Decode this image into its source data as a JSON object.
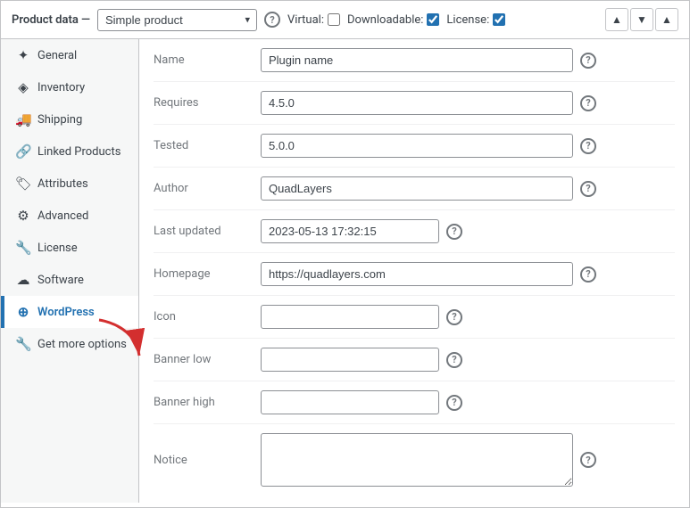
{
  "header": {
    "label": "Product data —",
    "product_type_value": "Simple product",
    "help_icon": "?",
    "virtual_label": "Virtual:",
    "virtual_checked": false,
    "downloadable_label": "Downloadable:",
    "downloadable_checked": true,
    "license_label": "License:",
    "license_checked": true,
    "nav_up": "▲",
    "nav_down": "▼",
    "nav_collapse": "▲"
  },
  "sidebar": {
    "items": [
      {
        "id": "general",
        "label": "General",
        "icon": "📄"
      },
      {
        "id": "inventory",
        "label": "Inventory",
        "icon": "📦"
      },
      {
        "id": "shipping",
        "label": "Shipping",
        "icon": "🚚"
      },
      {
        "id": "linked-products",
        "label": "Linked Products",
        "icon": "🔗"
      },
      {
        "id": "attributes",
        "label": "Attributes",
        "icon": "🏷"
      },
      {
        "id": "advanced",
        "label": "Advanced",
        "icon": "⚙"
      },
      {
        "id": "license",
        "label": "License",
        "icon": "🔧"
      },
      {
        "id": "software",
        "label": "Software",
        "icon": "☁"
      },
      {
        "id": "wordpress",
        "label": "WordPress",
        "icon": "⊕",
        "active": true
      },
      {
        "id": "get-more-options",
        "label": "Get more options",
        "icon": "🔧"
      }
    ]
  },
  "form": {
    "fields": [
      {
        "id": "name",
        "label": "Name",
        "type": "text",
        "value": "Plugin name",
        "placeholder": ""
      },
      {
        "id": "requires",
        "label": "Requires",
        "type": "text",
        "value": "4.5.0",
        "placeholder": ""
      },
      {
        "id": "tested",
        "label": "Tested",
        "type": "text",
        "value": "5.0.0",
        "placeholder": ""
      },
      {
        "id": "author",
        "label": "Author",
        "type": "text",
        "value": "QuadLayers",
        "placeholder": ""
      },
      {
        "id": "last-updated",
        "label": "Last updated",
        "type": "text",
        "value": "2023-05-13 17:32:15",
        "placeholder": "",
        "short": true
      },
      {
        "id": "homepage",
        "label": "Homepage",
        "type": "text",
        "value": "https://quadlayers.com",
        "placeholder": ""
      },
      {
        "id": "icon",
        "label": "Icon",
        "type": "text",
        "value": "",
        "placeholder": "",
        "short": true
      },
      {
        "id": "banner-low",
        "label": "Banner low",
        "type": "text",
        "value": "",
        "placeholder": "",
        "short": true
      },
      {
        "id": "banner-high",
        "label": "Banner high",
        "type": "text",
        "value": "",
        "placeholder": "",
        "short": true
      },
      {
        "id": "notice",
        "label": "Notice",
        "type": "textarea",
        "value": "",
        "placeholder": ""
      }
    ]
  }
}
